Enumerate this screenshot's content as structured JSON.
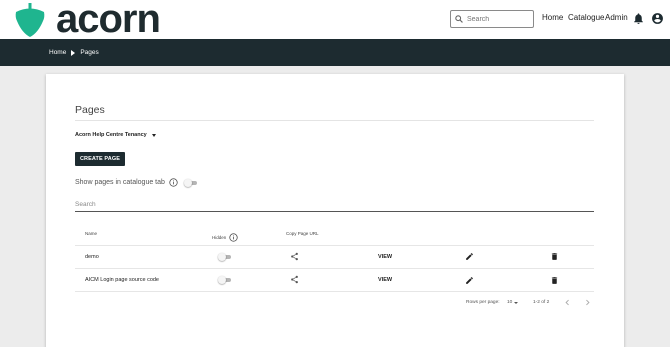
{
  "brand": {
    "name": "acorn",
    "leaf_color": "#1fb58f",
    "dark": "#1d2b30"
  },
  "header": {
    "search_placeholder": "Search",
    "nav": [
      "Home",
      "Catalogue",
      "Admin"
    ],
    "icons": [
      "bell-icon",
      "account-circle-icon"
    ]
  },
  "breadcrumb": [
    "Home",
    "Pages"
  ],
  "page": {
    "title": "Pages",
    "tenancy": "Acorn Help Centre Tenancy",
    "create_button": "CREATE PAGE",
    "show_in_catalogue_label": "Show pages in catalogue tab",
    "show_in_catalogue_on": false,
    "search_placeholder": "Search"
  },
  "table": {
    "columns": {
      "name": "Name",
      "hidden": "Hidden",
      "copy_url": "Copy Page URL"
    },
    "rows": [
      {
        "name": "demo",
        "hidden": false,
        "action": "VIEW"
      },
      {
        "name": "AICM Login page source code",
        "hidden": false,
        "action": "VIEW"
      }
    ]
  },
  "pagination": {
    "rows_per_page_label": "Rows per page:",
    "rows_per_page": "10",
    "range": "1-2 of 2"
  }
}
